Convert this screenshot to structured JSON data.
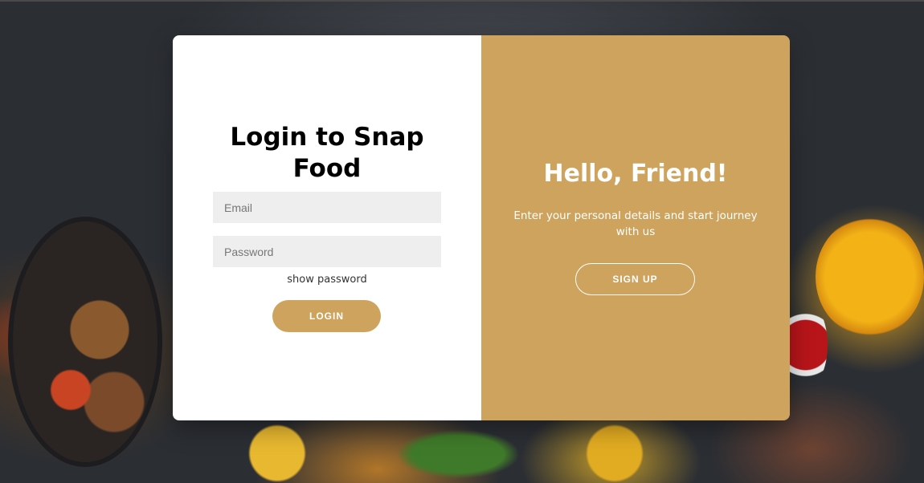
{
  "login": {
    "title": "Login to Snap Food",
    "email_placeholder": "Email",
    "email_value": "",
    "password_placeholder": "Password",
    "password_value": "",
    "show_password": "show password",
    "login_button": "LOGIN"
  },
  "signup_panel": {
    "title": "Hello, Friend!",
    "subtitle": "Enter your personal details and start journey with us",
    "signup_button": "SIGN UP"
  },
  "colors": {
    "accent": "#cda35e",
    "input_bg": "#eeeeee",
    "card_bg": "#ffffff"
  }
}
